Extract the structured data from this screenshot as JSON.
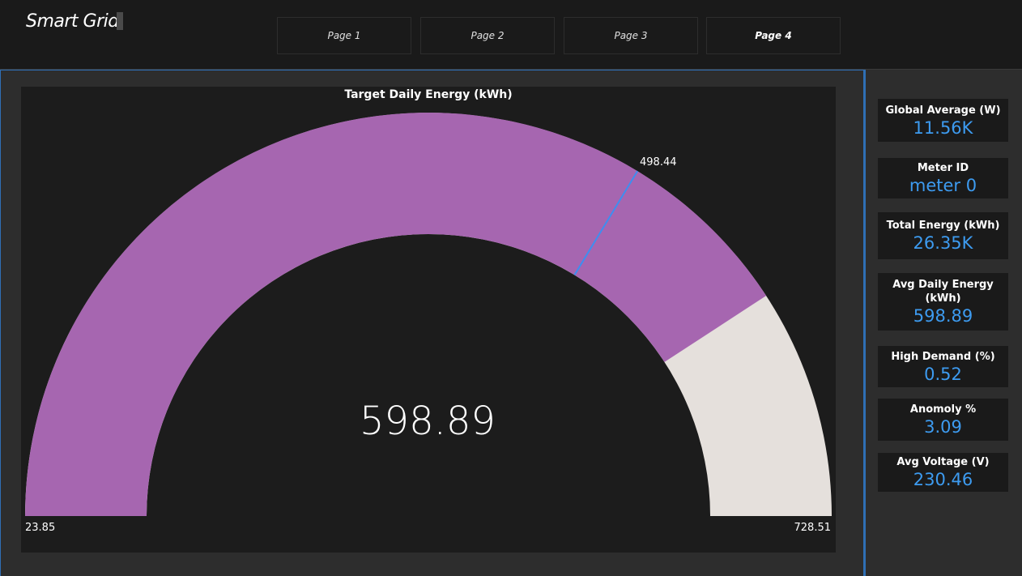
{
  "app": {
    "title": "Smart Grid"
  },
  "nav": {
    "pages": [
      {
        "label": "Page 1",
        "active": false
      },
      {
        "label": "Page 2",
        "active": false
      },
      {
        "label": "Page 3",
        "active": false
      },
      {
        "label": "Page 4",
        "active": true
      }
    ]
  },
  "gauge": {
    "title": "Target Daily Energy (kWh)",
    "value_label": "598.89",
    "min_label": "23.85",
    "max_label": "728.51",
    "target_label": "498.44",
    "fill_color": "#a666b0",
    "track_color": "#e5e0dc",
    "target_color": "#3d8ef0"
  },
  "chart_data": {
    "type": "gauge",
    "title": "Target Daily Energy (kWh)",
    "value": 598.89,
    "min": 23.85,
    "max": 728.51,
    "target": 498.44
  },
  "kpis": [
    {
      "label": "Global Average (W)",
      "value": "11.56K"
    },
    {
      "label": "Meter ID",
      "value": "meter  0"
    },
    {
      "label": "Total Energy (kWh)",
      "value": "26.35K"
    },
    {
      "label": "Avg Daily Energy (kWh)",
      "value": "598.89"
    },
    {
      "label": "High Demand (%)",
      "value": "0.52"
    },
    {
      "label": "Anomoly %",
      "value": "3.09"
    },
    {
      "label": "Avg Voltage (V)",
      "value": "230.46"
    }
  ]
}
